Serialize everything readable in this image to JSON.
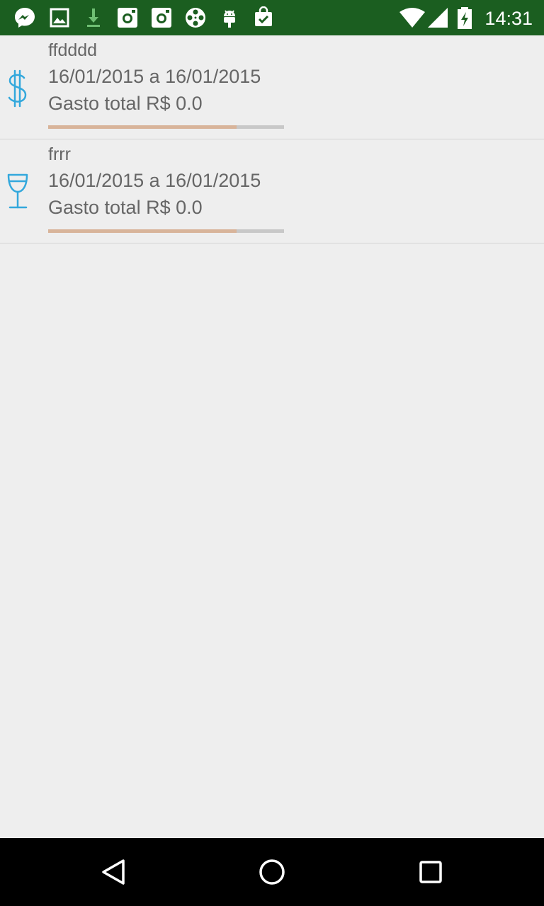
{
  "status_bar": {
    "time": "14:31",
    "notification_icons": [
      "messenger-icon",
      "gallery-icon",
      "download-icon",
      "instagram-icon",
      "instagram-icon",
      "film-reel-icon",
      "android-icon",
      "shopping-bag-check-icon"
    ],
    "status_icons": [
      "wifi-icon",
      "cell-signal-icon",
      "battery-charging-icon"
    ],
    "color": "#1b5e20"
  },
  "budgets": [
    {
      "name": "ffdddd",
      "period": "16/01/2015 a 16/01/2015",
      "total": "Gasto total R$ 0.0",
      "icon": "dollar-icon",
      "progress": 0.8
    },
    {
      "name": "frrr",
      "period": "16/01/2015 a 16/01/2015",
      "total": "Gasto total R$ 0.0",
      "icon": "wine-glass-icon",
      "progress": 0.8
    }
  ],
  "colors": {
    "icon": "#33a8dc",
    "progress_fill": "#d8b49a",
    "progress_track": "#c8c8c8"
  },
  "nav_bar": {
    "buttons": [
      "back-icon",
      "home-icon",
      "recents-icon"
    ]
  }
}
